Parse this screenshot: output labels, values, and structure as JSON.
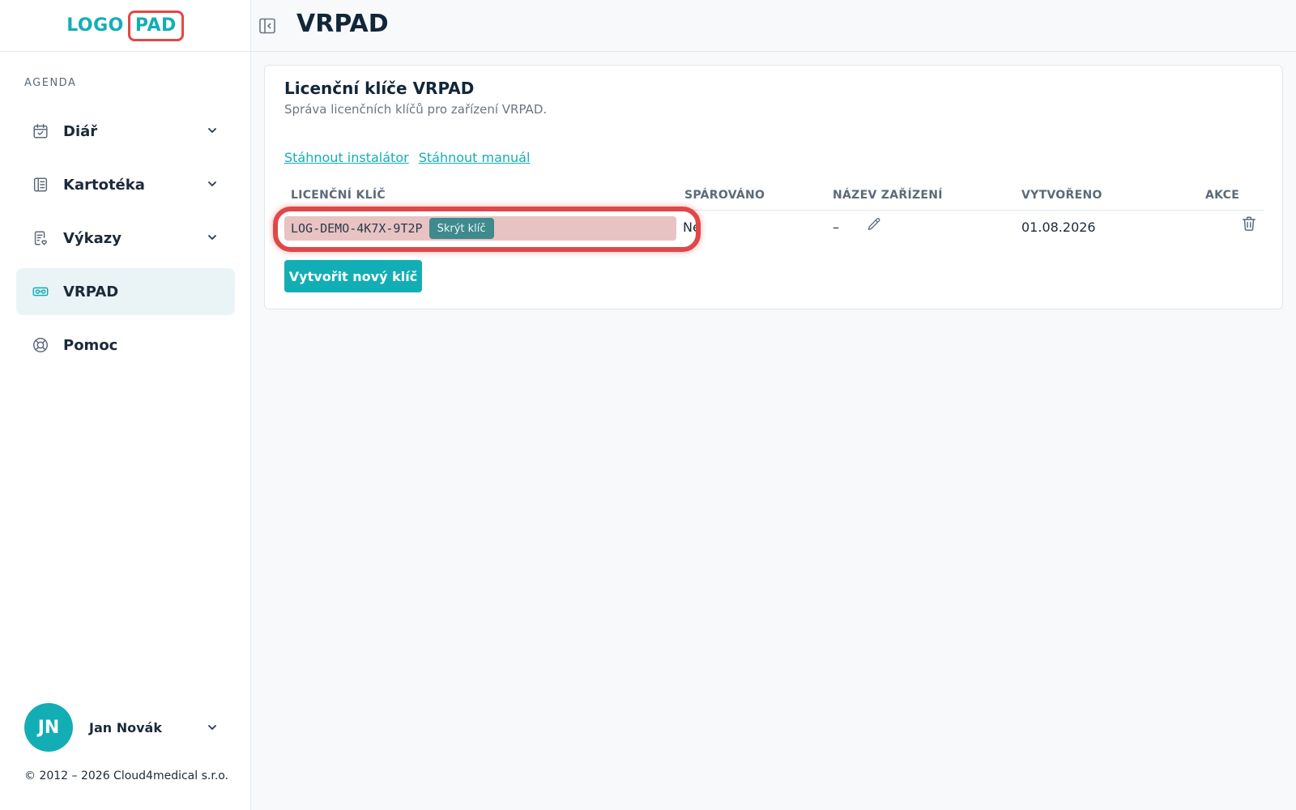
{
  "logo": {
    "part1": "LOGO",
    "part2": "PAD"
  },
  "sidebar": {
    "section_label": "AGENDA",
    "items": [
      {
        "label": "Diář",
        "icon": "calendar-check-icon",
        "has_submenu": true
      },
      {
        "label": "Kartotéka",
        "icon": "card-file-icon",
        "has_submenu": true
      },
      {
        "label": "Výkazy",
        "icon": "report-icon",
        "has_submenu": true
      },
      {
        "label": "VRPAD",
        "icon": "vr-headset-icon",
        "has_submenu": false,
        "active": true
      },
      {
        "label": "Pomoc",
        "icon": "lifebuoy-icon",
        "has_submenu": false
      }
    ]
  },
  "user": {
    "initials": "JN",
    "name": "Jan Novák"
  },
  "copyright": "© 2012 – 2026 Cloud4medical s.r.o.",
  "header": {
    "title": "VRPAD"
  },
  "card": {
    "title": "Licenční klíče VRPAD",
    "subtitle": "Správa licenčních klíčů pro zařízení VRPAD.",
    "links": {
      "installer": "Stáhnout instalátor",
      "manual": "Stáhnout manuál"
    }
  },
  "table": {
    "headers": {
      "key": "LICENČNÍ KLÍČ",
      "paired": "SPÁROVÁNO",
      "device": "NÁZEV ZAŘÍZENÍ",
      "created": "VYTVOŘENO",
      "actions": "AKCE"
    },
    "rows": [
      {
        "key": "LOG-DEMO-4K7X-9T2P",
        "key_button": "Skrýt klíč",
        "paired": "Ne",
        "device": "–",
        "created": "01.08.2026"
      }
    ]
  },
  "create_button": "Vytvořit nový klíč",
  "colors": {
    "accent": "#13aeb5",
    "highlight": "#e04848",
    "active_bg": "#eaf4f6"
  }
}
